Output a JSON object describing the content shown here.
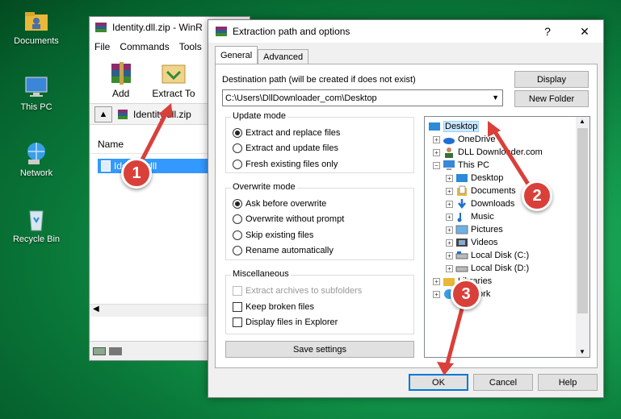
{
  "desktop": {
    "icons": [
      {
        "label": "Documents",
        "icon": "folder-user-icon"
      },
      {
        "label": "This PC",
        "icon": "computer-icon"
      },
      {
        "label": "Network",
        "icon": "network-icon"
      },
      {
        "label": "Recycle Bin",
        "icon": "recycle-bin-icon"
      }
    ]
  },
  "winrar": {
    "title": "Identity.dll.zip - WinR",
    "menu": [
      "File",
      "Commands",
      "Tools"
    ],
    "toolbar": {
      "add": "Add",
      "extract": "Extract To"
    },
    "address": "Identity.dll.zip",
    "column_name": "Name",
    "file": "Identity.dll"
  },
  "dialog": {
    "title": "Extraction path and options",
    "help_glyph": "?",
    "close_glyph": "✕",
    "tabs": [
      "General",
      "Advanced"
    ],
    "dest_label": "Destination path (will be created if does not exist)",
    "dest_value": "C:\\Users\\DllDownloader_com\\Desktop",
    "display_button": "Display",
    "new_folder_button": "New Folder",
    "update_mode": {
      "title": "Update mode",
      "options": [
        "Extract and replace files",
        "Extract and update files",
        "Fresh existing files only"
      ],
      "selected": 0
    },
    "overwrite_mode": {
      "title": "Overwrite mode",
      "options": [
        "Ask before overwrite",
        "Overwrite without prompt",
        "Skip existing files",
        "Rename automatically"
      ],
      "selected": 0
    },
    "misc": {
      "title": "Miscellaneous",
      "options": [
        "Extract archives to subfolders",
        "Keep broken files",
        "Display files in Explorer"
      ]
    },
    "save_settings": "Save settings",
    "ok": "OK",
    "cancel": "Cancel",
    "help": "Help",
    "tree": [
      {
        "label": "Desktop",
        "icon": "desktop-icon",
        "selected": true
      },
      {
        "label": "OneDrive",
        "icon": "cloud-icon"
      },
      {
        "label": "DLL Downloader.com",
        "icon": "user-icon"
      },
      {
        "label": "This PC",
        "icon": "computer-icon"
      },
      {
        "label": "Desktop",
        "icon": "desktop-icon"
      },
      {
        "label": "Documents",
        "icon": "documents-icon"
      },
      {
        "label": "Downloads",
        "icon": "download-icon"
      },
      {
        "label": "Music",
        "icon": "music-icon"
      },
      {
        "label": "Pictures",
        "icon": "pictures-icon"
      },
      {
        "label": "Videos",
        "icon": "videos-icon"
      },
      {
        "label": "Local Disk (C:)",
        "icon": "drive-icon"
      },
      {
        "label": "Local Disk (D:)",
        "icon": "drive-icon"
      },
      {
        "label": "Libraries",
        "icon": "folder-icon"
      },
      {
        "label": "Network",
        "icon": "network-icon"
      }
    ]
  },
  "annotations": {
    "step1": "1",
    "step2": "2",
    "step3": "3",
    "color": "#d9403a"
  }
}
